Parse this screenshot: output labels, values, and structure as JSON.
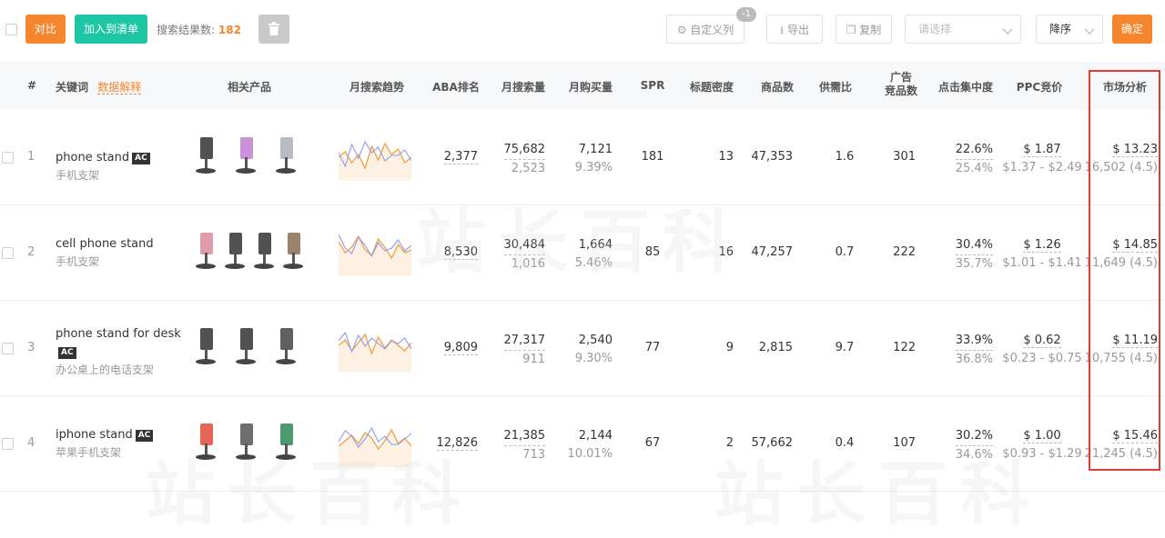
{
  "toolbar": {
    "compare_label": "对比",
    "add_list_label": "加入到清单",
    "result_count_label": "搜索结果数:",
    "result_count_value": "182",
    "custom_cols_label": "自定义列",
    "custom_cols_badge": "-1",
    "export_label": "导出",
    "copy_label": "复制",
    "select_placeholder": "请选择",
    "sort_label": "降序",
    "confirm_label": "确定"
  },
  "columns": {
    "index": "#",
    "keyword": "关键词",
    "keyword_help": "数据解释",
    "products": "相关产品",
    "trend": "月搜索趋势",
    "aba": "ABA排名",
    "monthly_search": "月搜索量",
    "monthly_buy": "月购买量",
    "spr": "SPR",
    "title_density": "标题密度",
    "product_count": "商品数",
    "supply_demand": "供需比",
    "ad_products_line1": "广告",
    "ad_products_line2": "竞品数",
    "click_concentration": "点击集中度",
    "ppc": "PPC竞价",
    "market": "市场分析"
  },
  "rows": [
    {
      "index": "1",
      "keyword": "phone stand",
      "ac": "AC",
      "keyword_cn": "手机支架",
      "aba": "2,377",
      "search": "75,682",
      "search_sub": "2,523",
      "buy": "7,121",
      "buy_sub": "9.39%",
      "spr": "181",
      "title_density": "13",
      "product_count": "47,353",
      "supply_demand": "1.6",
      "ad_products": "301",
      "click": "22.6%",
      "click_sub": "25.4%",
      "ppc": "$ 1.87",
      "ppc_range": "$1.37 - $2.49",
      "market": "$ 13.23",
      "market_sub": "16,502 (4.5)"
    },
    {
      "index": "2",
      "keyword": "cell phone stand",
      "ac": "",
      "keyword_cn": "手机支架",
      "aba": "8,530",
      "search": "30,484",
      "search_sub": "1,016",
      "buy": "1,664",
      "buy_sub": "5.46%",
      "spr": "85",
      "title_density": "16",
      "product_count": "47,257",
      "supply_demand": "0.7",
      "ad_products": "222",
      "click": "30.4%",
      "click_sub": "35.7%",
      "ppc": "$ 1.26",
      "ppc_range": "$1.01 - $1.41",
      "market": "$ 14.85",
      "market_sub": "11,649 (4.5)"
    },
    {
      "index": "3",
      "keyword": "phone stand for desk",
      "ac": "AC",
      "keyword_cn": "办公桌上的电话支架",
      "aba": "9,809",
      "search": "27,317",
      "search_sub": "911",
      "buy": "2,540",
      "buy_sub": "9.30%",
      "spr": "77",
      "title_density": "9",
      "product_count": "2,815",
      "supply_demand": "9.7",
      "ad_products": "122",
      "click": "33.9%",
      "click_sub": "36.8%",
      "ppc": "$ 0.62",
      "ppc_range": "$0.23 - $0.75",
      "market": "$ 11.19",
      "market_sub": "10,755 (4.5)"
    },
    {
      "index": "4",
      "keyword": "iphone stand",
      "ac": "AC",
      "keyword_cn": "苹果手机支架",
      "aba": "12,826",
      "search": "21,385",
      "search_sub": "713",
      "buy": "2,144",
      "buy_sub": "10.01%",
      "spr": "67",
      "title_density": "2",
      "product_count": "57,662",
      "supply_demand": "0.4",
      "ad_products": "107",
      "click": "30.2%",
      "click_sub": "34.6%",
      "ppc": "$ 1.00",
      "ppc_range": "$0.93 - $1.29",
      "market": "$ 15.46",
      "market_sub": "21,245 (4.5)"
    }
  ],
  "watermark": "站长百科",
  "colors": {
    "accent_orange": "#f5862e",
    "accent_teal": "#1dc7a5",
    "highlight_red": "#e23b32",
    "trend_orange": "#f0a040",
    "trend_blue": "#8c9cf0"
  }
}
